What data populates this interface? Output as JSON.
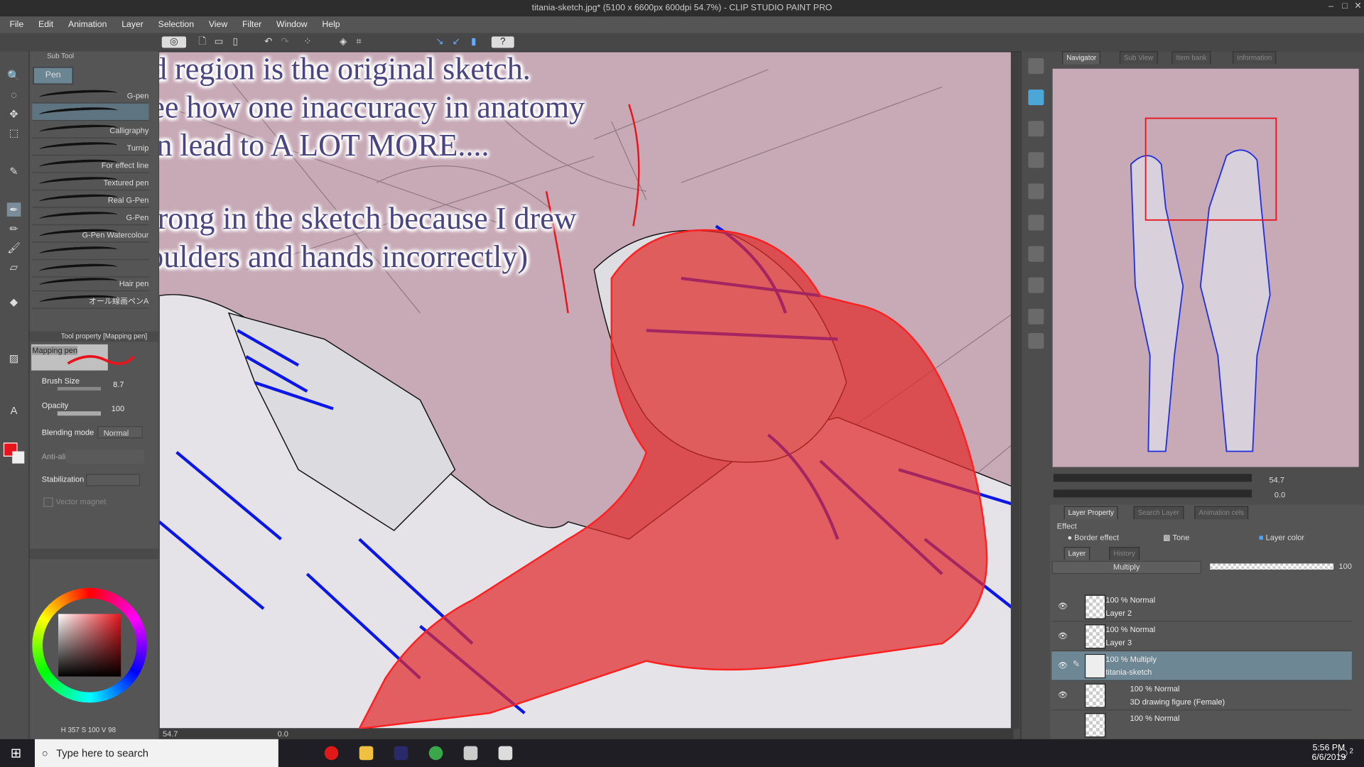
{
  "window": {
    "title": "titania-sketch.jpg* (5100 x 6600px 600dpi 54.7%) - CLIP STUDIO PAINT PRO"
  },
  "menu": [
    "File",
    "Edit",
    "Animation",
    "Layer",
    "Selection",
    "View",
    "Filter",
    "Window",
    "Help"
  ],
  "subtool": {
    "tab": "Sub Tool",
    "group": "Pen",
    "brushes": [
      "G-pen",
      "",
      "Calligraphy",
      "Turnip",
      "For effect line",
      "Textured pen",
      "Real G-Pen",
      "G-Pen",
      "G-Pen Watercolour",
      "",
      "",
      "Hair pen",
      "オール線画ペンA"
    ]
  },
  "tool_property": {
    "title": "Tool property [Mapping pen]",
    "preset": "Mapping pen",
    "brush_size_label": "Brush Size",
    "brush_size": "8.7",
    "opacity_label": "Opacity",
    "opacity": "100",
    "blending_label": "Blending mode",
    "blending": "Normal",
    "antialias_label": "Anti-alia",
    "stabilization_label": "Stabilization",
    "vector_magnet_label": "Vector magnet"
  },
  "color": {
    "readout": "H 357 S 100 V 98",
    "main": "#e8141c"
  },
  "canvas": {
    "zoom": "54.7",
    "rotation": "0.0",
    "overlay_lines": [
      "the red region is the original sketch.",
      "You can see how one inaccuracy in anatomy",
      "can lead to A LOT MORE....",
      "(I got it wrong in the sketch because I drew",
      "the shoulders and hands incorrectly)"
    ]
  },
  "navigator": {
    "tabs": [
      "Navigator",
      "Sub View",
      "Item bank",
      "Information"
    ],
    "zoom": "54.7",
    "rotation": "0.0"
  },
  "layer_property": {
    "tabs": [
      "Layer Property",
      "Search Layer",
      "Animation cels"
    ],
    "effect_label": "Effect",
    "effects": [
      "Border effect",
      "Tone",
      "Layer color"
    ]
  },
  "layers": {
    "tabs": [
      "Layer",
      "History"
    ],
    "blend": "Multiply",
    "opacity": "100",
    "rows": [
      {
        "mode": "100 % Normal",
        "name": "Layer 2",
        "selected": false
      },
      {
        "mode": "100 % Normal",
        "name": "Layer 3",
        "selected": false
      },
      {
        "mode": "100 % Multiply",
        "name": "titania-sketch",
        "selected": true
      },
      {
        "mode": "100 % Normal",
        "name": "3D drawing figure (Female)",
        "selected": false
      },
      {
        "mode": "100 % Normal",
        "name": "",
        "selected": false
      }
    ]
  },
  "taskbar": {
    "search_placeholder": "Type here to search",
    "time": "5:56 PM",
    "date": "6/6/2019",
    "notifications": "2"
  }
}
